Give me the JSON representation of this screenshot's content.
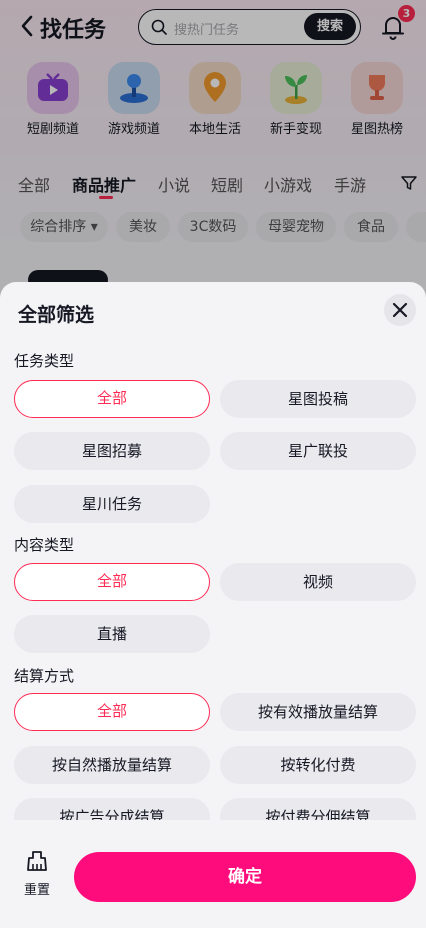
{
  "header": {
    "title": "找任务",
    "search_placeholder": "搜热门任务",
    "search_button": "搜索",
    "notification_count": "3"
  },
  "shortcuts": [
    {
      "label": "短剧频道",
      "icon": "tv-icon"
    },
    {
      "label": "游戏频道",
      "icon": "joystick-icon"
    },
    {
      "label": "本地生活",
      "icon": "map-pin-icon"
    },
    {
      "label": "新手变现",
      "icon": "sprout-icon"
    },
    {
      "label": "星图热榜",
      "icon": "trophy-icon"
    }
  ],
  "categories": [
    "全部",
    "商品推广",
    "小说",
    "短剧",
    "小游戏",
    "手游"
  ],
  "active_category": "商品推广",
  "chips": [
    "综合排序",
    "美妆",
    "3C数码",
    "母婴宠物",
    "食品"
  ],
  "sheet": {
    "title": "全部筛选",
    "sections": [
      {
        "title": "任务类型",
        "options": [
          "全部",
          "星图投稿",
          "星图招募",
          "星广联投",
          "星川任务"
        ],
        "selected": "全部"
      },
      {
        "title": "内容类型",
        "options": [
          "全部",
          "视频",
          "直播"
        ],
        "selected": "全部"
      },
      {
        "title": "结算方式",
        "options": [
          "全部",
          "按有效播放量结算",
          "按自然播放量结算",
          "按转化付费",
          "按广告分成结算",
          "按付费分佣结算"
        ],
        "selected": "全部"
      }
    ],
    "reset_label": "重置",
    "confirm_label": "确定"
  },
  "colors": {
    "accent": "#fe0c7b",
    "selected_border": "#fe2c55",
    "badge": "#fe2c55"
  }
}
